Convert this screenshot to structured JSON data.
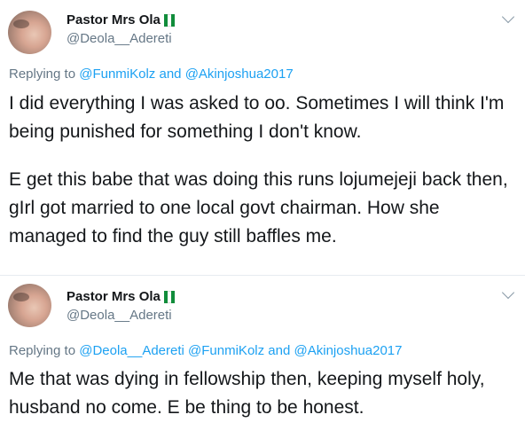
{
  "tweets": [
    {
      "author": "Pastor Mrs Ola",
      "handle": "@Deola__Adereti",
      "replying_prefix": "Replying to",
      "replying_mentions": [
        "@FunmiKolz"
      ],
      "replying_and": "and",
      "replying_last": "@Akinjoshua2017",
      "paragraphs": [
        "I did everything I was asked to oo. Sometimes I will think I'm being punished for something I don't know.",
        "E get this babe that was doing this runs lojumejeji back then, gIrl got married to one local govt chairman. How she managed to find the guy still baffles me."
      ]
    },
    {
      "author": "Pastor Mrs Ola",
      "handle": "@Deola__Adereti",
      "replying_prefix": "Replying to",
      "replying_mentions": [
        "@Deola__Adereti",
        "@FunmiKolz"
      ],
      "replying_and": "and",
      "replying_last": "@Akinjoshua2017",
      "paragraphs": [
        "Me that was dying in fellowship then, keeping myself holy, husband no come. E be thing to be honest."
      ]
    }
  ],
  "colors": {
    "text": "#14171a",
    "secondary": "#657786",
    "link": "#1da1f2",
    "divider": "#e6ecf0",
    "flag_green": "#118d3b"
  },
  "icons": [
    "chevron-down-icon",
    "nigeria-flag-icon"
  ]
}
